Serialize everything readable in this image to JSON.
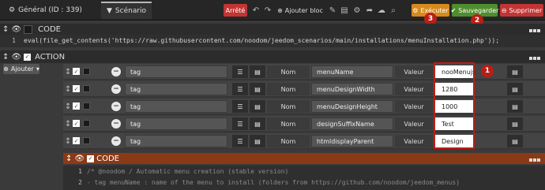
{
  "tabs": [
    {
      "icon": "gear-icon",
      "label": "Général (ID : 339)"
    },
    {
      "icon": "filter-icon",
      "label": "Scénario"
    }
  ],
  "toolbar": {
    "state": "Arrêté",
    "add_block": "Ajouter bloc",
    "execute": "Exécuter",
    "save": "Sauvegarder",
    "delete": "Supprimer"
  },
  "code_block_1": {
    "title": "CODE",
    "line_no": "1",
    "code": "eval(file_get_contents('https://raw.githubusercontent.com/noodom/jeedom_scenarios/main/installations/menuInstallation.php'));"
  },
  "action_block": {
    "title": "ACTION",
    "add_label": "Ajouter"
  },
  "rows": [
    {
      "type": "tag",
      "nom_label": "Nom",
      "name": "menuName",
      "valeur_label": "Valeur",
      "value": "nooMenujs"
    },
    {
      "type": "tag",
      "nom_label": "Nom",
      "name": "menuDesignWidth",
      "valeur_label": "Valeur",
      "value": "1280"
    },
    {
      "type": "tag",
      "nom_label": "Nom",
      "name": "menuDesignHeight",
      "valeur_label": "Valeur",
      "value": "1000"
    },
    {
      "type": "tag",
      "nom_label": "Nom",
      "name": "designSuffixName",
      "valeur_label": "Valeur",
      "value": "Test"
    },
    {
      "type": "tag",
      "nom_label": "Nom",
      "name": "htmldisplayParent",
      "valeur_label": "Valeur",
      "value": "Design"
    }
  ],
  "code_block_2": {
    "title": "CODE",
    "lines": [
      {
        "no": "1",
        "text": "/* @noodom / Automatic menu creation (stable version)"
      },
      {
        "no": "2",
        "text": "   - tag menuName : name of the menu to install (folders from https://github.com/noodom/jeedom_menus)"
      }
    ]
  },
  "markers": [
    "1",
    "2",
    "3"
  ],
  "colors": {
    "execute": "#d78a1c",
    "save": "#4f8e2e",
    "delete": "#c33434",
    "state": "#c33434",
    "marker": "#b91e16",
    "code_bar": "#8a3a16"
  }
}
